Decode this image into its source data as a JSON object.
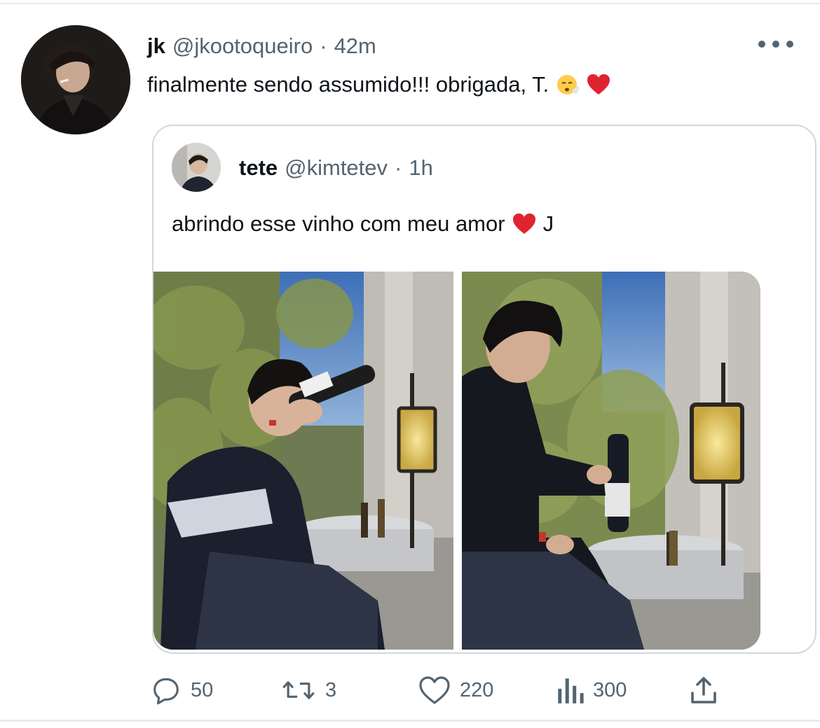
{
  "tweet": {
    "author": {
      "display_name": "jk",
      "handle": "@jkootoqueiro"
    },
    "separator": "·",
    "time": "42m",
    "text": "finalmente sendo assumido!!! obrigada, T.",
    "emojis": [
      "face-exhaling-emoji",
      "red-heart-emoji"
    ]
  },
  "quoted_tweet": {
    "author": {
      "display_name": "tete",
      "handle": "@kimtetev"
    },
    "separator": "·",
    "time": "1h",
    "text_before": "abrindo esse vinho com meu amor",
    "text_after": "J",
    "photos": [
      {
        "description_icon": "photo"
      },
      {
        "description_icon": "photo"
      }
    ]
  },
  "actions": {
    "replies": "50",
    "retweets": "3",
    "likes": "220",
    "views": "300"
  },
  "colors": {
    "text_primary": "#0f1419",
    "text_secondary": "#536471",
    "border": "#cfd9de",
    "heart": "#e0242f"
  },
  "icons": [
    "more-icon",
    "reply-icon",
    "retweet-icon",
    "like-icon",
    "views-icon",
    "share-icon"
  ]
}
